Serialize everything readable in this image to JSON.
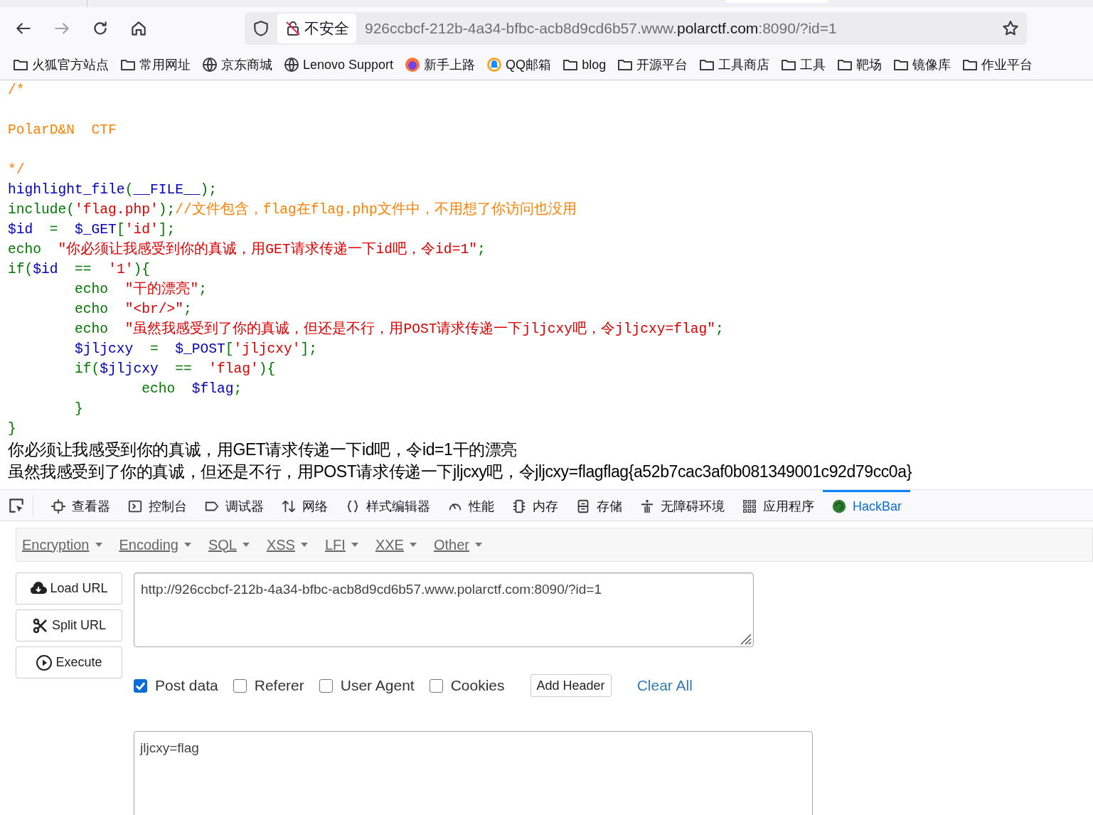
{
  "toolbar": {
    "security_label": "不安全",
    "url_parts": [
      {
        "text": "926ccbcf-212b-4a34-bfbc-acb8d9cd6b57.www.",
        "kind": "dim"
      },
      {
        "text": "polarctf.com",
        "kind": "host"
      },
      {
        "text": ":8090/?id=1",
        "kind": "dim"
      }
    ]
  },
  "bookmarks": [
    {
      "label": "火狐官方站点",
      "kind": "folder"
    },
    {
      "label": "常用网址",
      "kind": "folder"
    },
    {
      "label": "京东商城",
      "kind": "globe"
    },
    {
      "label": "Lenovo Support",
      "kind": "globe"
    },
    {
      "label": "新手上路",
      "kind": "firefox"
    },
    {
      "label": "QQ邮箱",
      "kind": "qq"
    },
    {
      "label": "blog",
      "kind": "folder"
    },
    {
      "label": "开源平台",
      "kind": "folder"
    },
    {
      "label": "工具商店",
      "kind": "folder"
    },
    {
      "label": "工具",
      "kind": "folder"
    },
    {
      "label": "靶场",
      "kind": "folder"
    },
    {
      "label": "镜像库",
      "kind": "folder"
    },
    {
      "label": "作业平台",
      "kind": "folder"
    }
  ],
  "code_lines": [
    [
      {
        "kind": "comment",
        "text": "/*\n\nPolarD&N  CTF\n\n*/"
      }
    ],
    [
      {
        "kind": "default",
        "text": "highlight_file"
      },
      {
        "kind": "keyword",
        "text": "("
      },
      {
        "kind": "default",
        "text": "__FILE__"
      },
      {
        "kind": "keyword",
        "text": ");"
      }
    ],
    [
      {
        "kind": "keyword",
        "text": "include("
      },
      {
        "kind": "string",
        "text": "'flag.php'"
      },
      {
        "kind": "keyword",
        "text": ");"
      },
      {
        "kind": "comment",
        "text": "//文件包含，flag在flag.php文件中，不用想了你访问也没用"
      }
    ],
    [
      {
        "kind": "default",
        "text": "$id"
      },
      {
        "kind": "keyword",
        "text": "  =  "
      },
      {
        "kind": "default",
        "text": "$_GET"
      },
      {
        "kind": "keyword",
        "text": "["
      },
      {
        "kind": "string",
        "text": "'id'"
      },
      {
        "kind": "keyword",
        "text": "];"
      }
    ],
    [
      {
        "kind": "keyword",
        "text": "echo  "
      },
      {
        "kind": "string",
        "text": "\"你必须让我感受到你的真诚，用GET请求传递一下id吧，令id=1\""
      },
      {
        "kind": "keyword",
        "text": ";"
      }
    ],
    [
      {
        "kind": "keyword",
        "text": "if("
      },
      {
        "kind": "default",
        "text": "$id"
      },
      {
        "kind": "keyword",
        "text": "  ==  "
      },
      {
        "kind": "string",
        "text": "'1'"
      },
      {
        "kind": "keyword",
        "text": "){"
      }
    ],
    [
      {
        "kind": "keyword",
        "text": "        echo  "
      },
      {
        "kind": "string",
        "text": "\"干的漂亮\""
      },
      {
        "kind": "keyword",
        "text": ";"
      }
    ],
    [
      {
        "kind": "keyword",
        "text": "        echo  "
      },
      {
        "kind": "string",
        "text": "\"<br/>\""
      },
      {
        "kind": "keyword",
        "text": ";"
      }
    ],
    [
      {
        "kind": "keyword",
        "text": "        echo  "
      },
      {
        "kind": "string",
        "text": "\"虽然我感受到了你的真诚，但还是不行，用POST请求传递一下jljcxy吧，令jljcxy=flag\""
      },
      {
        "kind": "keyword",
        "text": ";"
      }
    ],
    [
      {
        "kind": "default",
        "text": "        $jljcxy"
      },
      {
        "kind": "keyword",
        "text": "  =  "
      },
      {
        "kind": "default",
        "text": "$_POST"
      },
      {
        "kind": "keyword",
        "text": "["
      },
      {
        "kind": "string",
        "text": "'jljcxy'"
      },
      {
        "kind": "keyword",
        "text": "];"
      }
    ],
    [
      {
        "kind": "keyword",
        "text": "        if("
      },
      {
        "kind": "default",
        "text": "$jljcxy"
      },
      {
        "kind": "keyword",
        "text": "  ==  "
      },
      {
        "kind": "string",
        "text": "'flag'"
      },
      {
        "kind": "keyword",
        "text": "){"
      }
    ],
    [
      {
        "kind": "keyword",
        "text": "                echo  "
      },
      {
        "kind": "default",
        "text": "$flag"
      },
      {
        "kind": "keyword",
        "text": ";"
      }
    ],
    [
      {
        "kind": "keyword",
        "text": "        }"
      }
    ],
    [
      {
        "kind": "keyword",
        "text": "}"
      }
    ]
  ],
  "output_lines": [
    "你必须让我感受到你的真诚，用GET请求传递一下id吧，令id=1干的漂亮",
    "虽然我感受到了你的真诚，但还是不行，用POST请求传递一下jljcxy吧，令jljcxy=flagflag{a52b7cac3af0b081349001c92d79cc0a}"
  ],
  "devtools_tabs": [
    {
      "label": "查看器",
      "kind": "inspector",
      "selected": false
    },
    {
      "label": "控制台",
      "kind": "console",
      "selected": false
    },
    {
      "label": "调试器",
      "kind": "debugger",
      "selected": false
    },
    {
      "label": "网络",
      "kind": "network",
      "selected": false
    },
    {
      "label": "样式编辑器",
      "kind": "style",
      "selected": false
    },
    {
      "label": "性能",
      "kind": "performance",
      "selected": false
    },
    {
      "label": "内存",
      "kind": "memory",
      "selected": false
    },
    {
      "label": "存储",
      "kind": "storage",
      "selected": false
    },
    {
      "label": "无障碍环境",
      "kind": "accessibility",
      "selected": false
    },
    {
      "label": "应用程序",
      "kind": "application",
      "selected": false
    },
    {
      "label": "HackBar",
      "kind": "hackbar",
      "selected": true
    }
  ],
  "hackbar": {
    "menus": [
      "Encryption",
      "Encoding",
      "SQL",
      "XSS",
      "LFI",
      "XXE",
      "Other"
    ],
    "actions": [
      {
        "label": "Load URL",
        "kind": "load"
      },
      {
        "label": "Split URL",
        "kind": "split"
      },
      {
        "label": "Execute",
        "kind": "execute"
      }
    ],
    "url_value": "http://926ccbcf-212b-4a34-bfbc-acb8d9cd6b57.www.polarctf.com:8090/?id=1",
    "options": [
      {
        "label": "Post data",
        "checked": true
      },
      {
        "label": "Referer",
        "checked": false
      },
      {
        "label": "User Agent",
        "checked": false
      },
      {
        "label": "Cookies",
        "checked": false
      }
    ],
    "add_header": "Add Header",
    "clear_all": "Clear All",
    "post_value": "jljcxy=flag"
  }
}
